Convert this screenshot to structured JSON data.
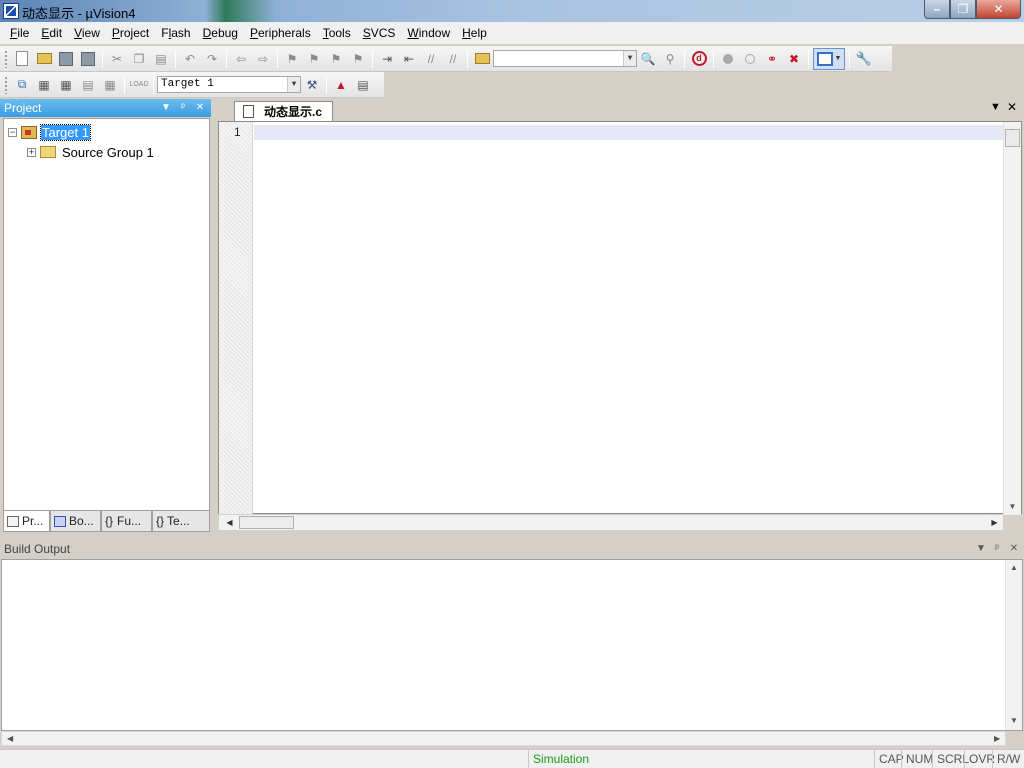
{
  "window": {
    "title": "动态显示  - µVision4",
    "buttons": {
      "minimize": "–",
      "maximize": "❐",
      "close": "✕"
    }
  },
  "menubar": {
    "items": [
      {
        "label": "File",
        "mnemonic": "F",
        "rest": "ile"
      },
      {
        "label": "Edit",
        "mnemonic": "E",
        "rest": "dit"
      },
      {
        "label": "View",
        "mnemonic": "V",
        "rest": "iew"
      },
      {
        "label": "Project",
        "mnemonic": "P",
        "rest": "roject"
      },
      {
        "label": "Flash",
        "pre": "F",
        "mnemonic": "l",
        "rest": "ash"
      },
      {
        "label": "Debug",
        "mnemonic": "D",
        "rest": "ebug"
      },
      {
        "label": "Peripherals",
        "mnemonic": "P",
        "rest": "eripherals"
      },
      {
        "label": "Tools",
        "mnemonic": "T",
        "rest": "ools"
      },
      {
        "label": "SVCS",
        "mnemonic": "S",
        "rest": "VCS"
      },
      {
        "label": "Window",
        "mnemonic": "W",
        "rest": "indow"
      },
      {
        "label": "Help",
        "mnemonic": "H",
        "rest": "elp"
      }
    ]
  },
  "toolbar2": {
    "target_select": "Target 1"
  },
  "project_panel": {
    "title": "Project",
    "tree": {
      "root": "Target 1",
      "children": [
        "Source Group 1"
      ]
    },
    "tabs": [
      "Pr...",
      "Bo...",
      "Fu...",
      "Te..."
    ]
  },
  "editor": {
    "tab_label": "动态显示.c",
    "line_numbers": [
      "1"
    ]
  },
  "build_output": {
    "title": "Build Output"
  },
  "statusbar": {
    "mode": "Simulation",
    "indicators": [
      "CAP",
      "NUM",
      "SCRL",
      "OVR",
      "R/W"
    ]
  },
  "colors": {
    "accent_panel": "#3b9de0",
    "selection": "#3399ff",
    "status_green": "#1a9a1a"
  }
}
